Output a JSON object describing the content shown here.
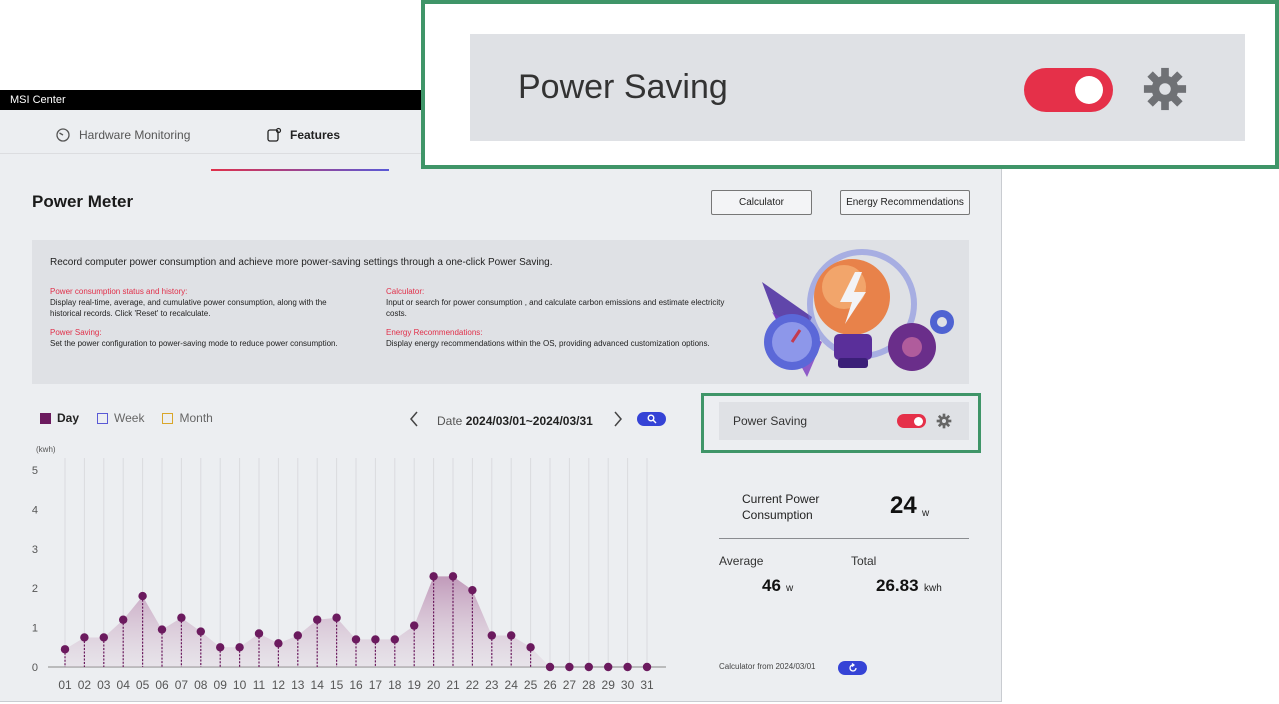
{
  "window": {
    "title": "MSI Center"
  },
  "tabs": [
    {
      "label": "Hardware Monitoring"
    },
    {
      "label": "Features"
    }
  ],
  "page": {
    "title": "Power Meter"
  },
  "header_buttons": {
    "calculator": "Calculator",
    "energy": "Energy Recommendations"
  },
  "info": {
    "intro": "Record computer power consumption and achieve more power-saving settings through a one-click Power Saving.",
    "sections": [
      {
        "heading": "Power consumption status and history:",
        "lines": [
          "Display real-time, average, and cumulative power consumption, along with the",
          "historical records. Click 'Reset' to recalculate."
        ]
      },
      {
        "heading": "Power Saving:",
        "lines": [
          "Set the power configuration to power-saving mode to reduce power consumption."
        ]
      },
      {
        "heading": "Calculator:",
        "lines": [
          "Input or search for power consumption , and calculate carbon emissions and estimate electricity",
          "costs."
        ]
      },
      {
        "heading": "Energy Recommendations:",
        "lines": [
          "Display energy recommendations within the OS, providing advanced customization options."
        ]
      }
    ]
  },
  "period": {
    "day": "Day",
    "week": "Week",
    "month": "Month",
    "selected": "Day"
  },
  "date": {
    "label": "Date",
    "value": "2024/03/01~2024/03/31"
  },
  "power_saving": {
    "label": "Power Saving",
    "enabled": true
  },
  "stats": {
    "current_label": "Current Power Consumption",
    "current_value": "24",
    "current_unit": "w",
    "average_label": "Average",
    "average_value": "46",
    "average_unit": "w",
    "total_label": "Total",
    "total_value": "26.83",
    "total_unit": "kwh",
    "calc_from": "Calculator from 2024/03/01"
  },
  "zoom": {
    "label": "Power Saving",
    "enabled": true
  },
  "colors": {
    "accent_red": "#e53049",
    "accent_blue": "#3543d6",
    "series": "#6b1a5e",
    "highlight": "#3f9568"
  },
  "chart_data": {
    "type": "area",
    "ylabel": "(kwh)",
    "ylim": [
      0,
      5
    ],
    "yticks": [
      "0",
      "1",
      "2",
      "3",
      "4",
      "5"
    ],
    "categories": [
      "01",
      "02",
      "03",
      "04",
      "05",
      "06",
      "07",
      "08",
      "09",
      "10",
      "11",
      "12",
      "13",
      "14",
      "15",
      "16",
      "17",
      "18",
      "19",
      "20",
      "21",
      "22",
      "23",
      "24",
      "25",
      "26",
      "27",
      "28",
      "29",
      "30",
      "31"
    ],
    "values": [
      0.45,
      0.75,
      0.75,
      1.2,
      1.8,
      0.95,
      1.25,
      0.9,
      0.5,
      0.5,
      0.85,
      0.6,
      0.8,
      1.2,
      1.25,
      0.7,
      0.7,
      0.7,
      1.05,
      2.3,
      2.3,
      1.95,
      0.8,
      0.8,
      0.5,
      0,
      0,
      0,
      0,
      0,
      0
    ]
  }
}
